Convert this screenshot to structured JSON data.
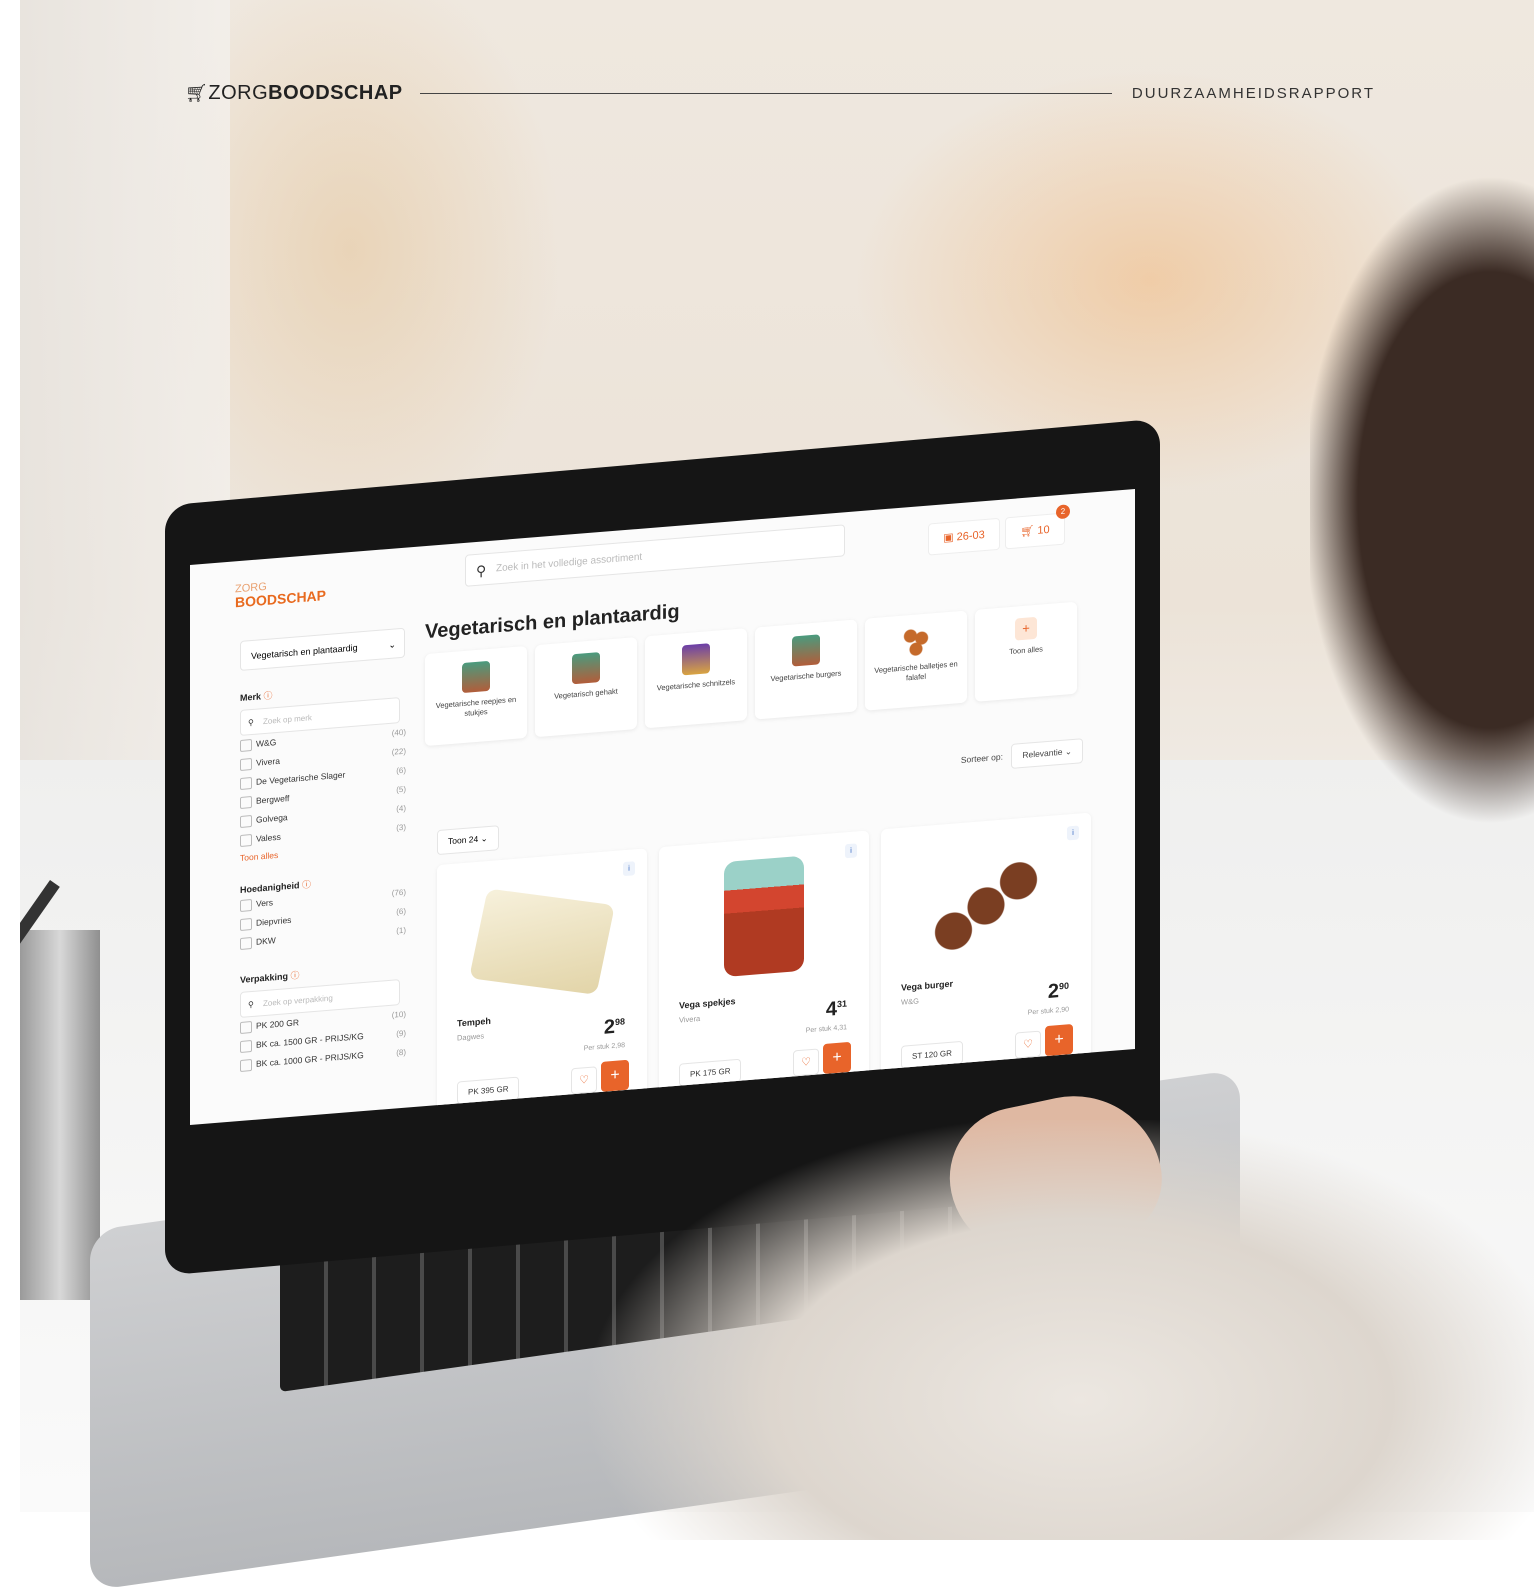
{
  "header": {
    "logo_light": "ZORG",
    "logo_bold": "BOODSCHAP",
    "right_label": "DUURZAAMHEIDSRAPPORT"
  },
  "screen": {
    "logo_top": "ZORG",
    "logo_bottom": "BOODSCHAP",
    "search_placeholder": "Zoek in het volledige assortiment",
    "delivery_date": "26-03",
    "cart_total": "10",
    "cart_count": "2",
    "category_select": "Vegetarisch en plantaardig",
    "page_title": "Vegetarisch en plantaardig",
    "filters": {
      "merk": {
        "title": "Merk",
        "search_placeholder": "Zoek op merk",
        "options": [
          {
            "label": "W&G",
            "count": "(40)"
          },
          {
            "label": "Vivera",
            "count": "(22)"
          },
          {
            "label": "De Vegetarische Slager",
            "count": "(6)"
          },
          {
            "label": "Bergweff",
            "count": "(5)"
          },
          {
            "label": "Golvega",
            "count": "(4)"
          },
          {
            "label": "Valess",
            "count": "(3)"
          }
        ],
        "more": "Toon alles"
      },
      "hoedanigheid": {
        "title": "Hoedanigheid",
        "options": [
          {
            "label": "Vers",
            "count": "(76)"
          },
          {
            "label": "Diepvries",
            "count": "(6)"
          },
          {
            "label": "DKW",
            "count": "(1)"
          }
        ]
      },
      "verpakking": {
        "title": "Verpakking",
        "search_placeholder": "Zoek op verpakking",
        "options": [
          {
            "label": "PK 200 GR",
            "count": "(10)"
          },
          {
            "label": "BK ca. 1500 GR - PRIJS/KG",
            "count": "(9)"
          },
          {
            "label": "BK ca. 1000 GR - PRIJS/KG",
            "count": "(8)"
          }
        ]
      }
    },
    "categories": [
      {
        "label": "Vegetarische reepjes en stukjes"
      },
      {
        "label": "Vegetarisch gehakt"
      },
      {
        "label": "Vegetarische schnitzels"
      },
      {
        "label": "Vegetarische burgers"
      },
      {
        "label": "Vegetarische balletjes en falafel"
      },
      {
        "label": "Toon alles"
      }
    ],
    "sort_label": "Sorteer op:",
    "sort_value": "Relevantie",
    "show_count": "Toon 24",
    "products": [
      {
        "name": "Tempeh",
        "brand": "Dagwes",
        "price_main": "2",
        "price_cents": "98",
        "unit_price": "Per stuk 2,98",
        "pack": "PK 395 GR"
      },
      {
        "name": "Vega spekjes",
        "brand": "Vivera",
        "price_main": "4",
        "price_cents": "31",
        "unit_price": "Per stuk 4,31",
        "pack": "PK 175 GR"
      },
      {
        "name": "Vega burger",
        "brand": "W&G",
        "price_main": "2",
        "price_cents": "90",
        "unit_price": "Per stuk 2,90",
        "pack": "ST 120 GR"
      }
    ]
  },
  "colors": {
    "accent": "#e8642a",
    "text": "#222222"
  },
  "icons": {
    "cart": "cart-icon",
    "search": "search-icon",
    "calendar": "calendar-icon",
    "heart": "heart-icon",
    "plus": "plus-icon",
    "info": "info-icon",
    "chevron": "chevron-down-icon"
  }
}
